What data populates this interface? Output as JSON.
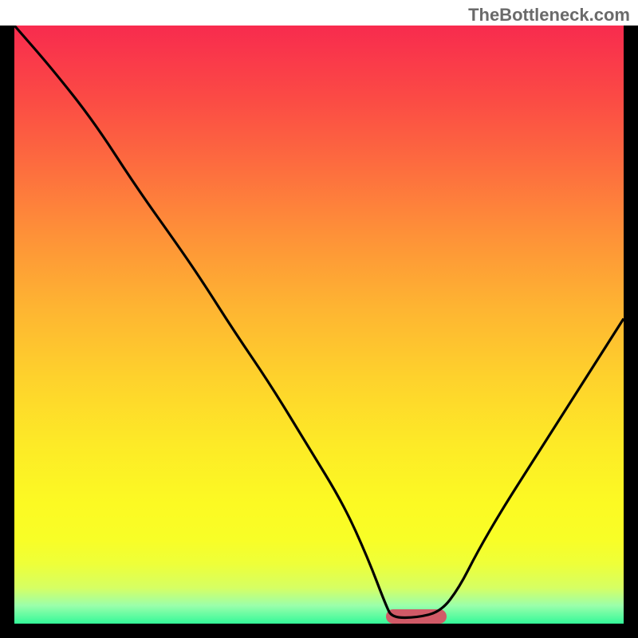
{
  "watermark": "TheBottleneck.com",
  "colors": {
    "outer_border": "#000000",
    "curve": "#000000",
    "pill": "#D15A67",
    "gradient_top": "#F82B4E",
    "gradient_bottom": "#34F999",
    "watermark": "#6a6a6a"
  },
  "chart_data": {
    "type": "line",
    "title": "",
    "xlabel": "",
    "ylabel": "",
    "xlim": [
      0,
      100
    ],
    "ylim": [
      0,
      100
    ],
    "grid": false,
    "legend": false,
    "series": [
      {
        "name": "bottleneck-curve",
        "x": [
          0,
          6,
          13,
          20,
          27,
          31,
          36,
          42,
          48,
          54,
          58,
          61,
          62,
          66,
          70,
          73,
          76,
          80,
          85,
          90,
          95,
          100
        ],
        "values": [
          100,
          93,
          84,
          73,
          63,
          57,
          49,
          40,
          30,
          20,
          11,
          3,
          1,
          1,
          2,
          6,
          12,
          19,
          27,
          35,
          43,
          51
        ]
      }
    ],
    "marker": {
      "x_center": 66,
      "width_pct": 10,
      "name": "target-zone"
    }
  }
}
